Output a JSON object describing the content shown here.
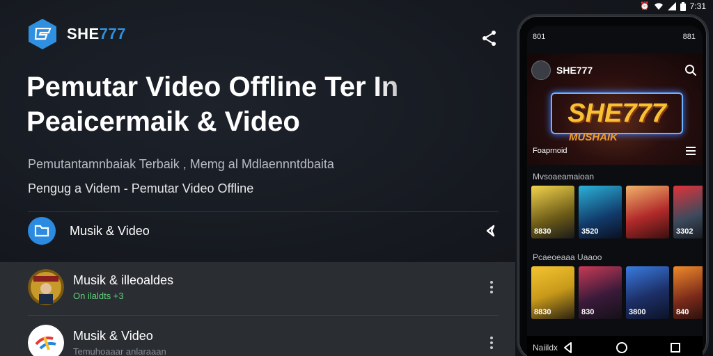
{
  "status_bar": {
    "time": "7:31",
    "icons": [
      "alarm-icon",
      "wifi-icon",
      "signal-icon",
      "battery-icon"
    ]
  },
  "brand": {
    "name_prefix": "SHE",
    "name_accent": "777",
    "logo_icon": "hex-logo-icon"
  },
  "hero": {
    "title_line1": "Pemutar Video Offline Ter In",
    "title_line2": "Peaicermaik & Video"
  },
  "subtitles": {
    "line1": "Pemutantamnbaiak Terbaik , Memg al Mdlaennntdbaita",
    "line2": "Pengug a Videm - Pemutar Video Offline"
  },
  "category": {
    "label": "Musik & Video",
    "icon": "folder-icon",
    "arrow_icon": "chevron-left-icon"
  },
  "list": [
    {
      "title": "Musik & illeoaldes",
      "subtitle": "On  ilaldts +3",
      "thumb": "album-thumb"
    },
    {
      "title": "Musik & Video",
      "subtitle": "Temuhoaaar anlaraaan",
      "thumb": "app-logo-thumb"
    }
  ],
  "phone": {
    "status_time": "801",
    "status_right": "881",
    "header_brand": "SHE777",
    "banner_logo": "SHE777",
    "banner_logo_sub": "MUSHAIK",
    "banner_label": "Foaprnoid",
    "section1_title": "Mvsoaeamaioan",
    "section1_cards": [
      "8830",
      "3520",
      "",
      "3302"
    ],
    "section2_title": "Pcaeoeaaa Uaaoo",
    "section2_cards": [
      "8830",
      "830",
      "3800",
      "840"
    ],
    "nav_label": "Naiildx"
  },
  "colors": {
    "accent": "#2f8fe0",
    "list_panel": "#2a2d32",
    "background": "#14171d",
    "green_sub": "#5fd07a"
  }
}
